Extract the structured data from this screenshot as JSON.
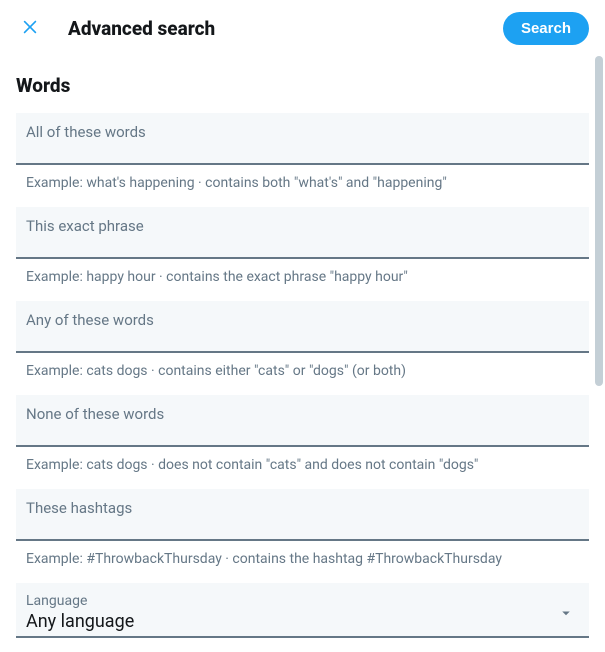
{
  "header": {
    "title": "Advanced search",
    "search_button": "Search"
  },
  "section": {
    "title": "Words"
  },
  "fields": {
    "all_words": {
      "label": "All of these words",
      "example": "Example: what's happening · contains both \"what's\" and \"happening\""
    },
    "exact_phrase": {
      "label": "This exact phrase",
      "example": "Example: happy hour · contains the exact phrase \"happy hour\""
    },
    "any_words": {
      "label": "Any of these words",
      "example": "Example: cats dogs · contains either \"cats\" or \"dogs\" (or both)"
    },
    "none_words": {
      "label": "None of these words",
      "example": "Example: cats dogs · does not contain \"cats\" and does not contain \"dogs\""
    },
    "hashtags": {
      "label": "These hashtags",
      "example": "Example: #ThrowbackThursday · contains the hashtag #ThrowbackThursday"
    },
    "language": {
      "label": "Language",
      "value": "Any language"
    }
  }
}
